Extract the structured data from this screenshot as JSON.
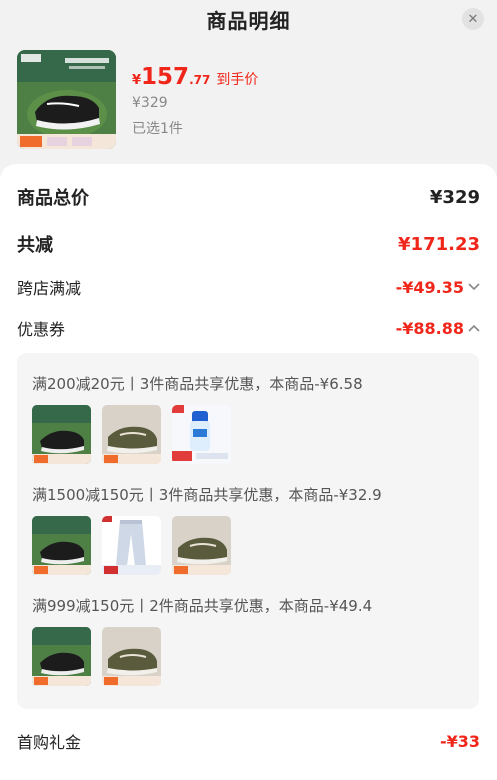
{
  "header": {
    "title": "商品明细",
    "close_icon": "close-icon"
  },
  "product": {
    "price_currency": "¥",
    "price_int": "157",
    "price_dec": ".77",
    "price_tag": "到手价",
    "original_price": "¥329",
    "selected": "已选1件"
  },
  "summary": {
    "total_label": "商品总价",
    "total_value": "¥329",
    "discount_label": "共减",
    "discount_value": "¥171.23",
    "cross_store_label": "跨店满减",
    "cross_store_value": "-¥49.35",
    "coupon_label": "优惠券",
    "coupon_value": "-¥88.88",
    "first_buy_label": "首购礼金",
    "first_buy_value": "-¥33"
  },
  "coupons": [
    {
      "title": "满200减20元丨3件商品共享优惠，本商品-¥6.58",
      "items": [
        "shoe-black",
        "shoe-olive",
        "product-blue"
      ]
    },
    {
      "title": "满1500减150元丨3件商品共享优惠，本商品-¥32.9",
      "items": [
        "shoe-black",
        "pants-jeans",
        "shoe-olive"
      ]
    },
    {
      "title": "满999减150元丨2件商品共享优惠，本商品-¥49.4",
      "items": [
        "shoe-black",
        "shoe-olive"
      ]
    }
  ],
  "colors": {
    "accent_red": "#f0261a",
    "muted": "#888888",
    "panel_bg": "#f5f5f5"
  }
}
